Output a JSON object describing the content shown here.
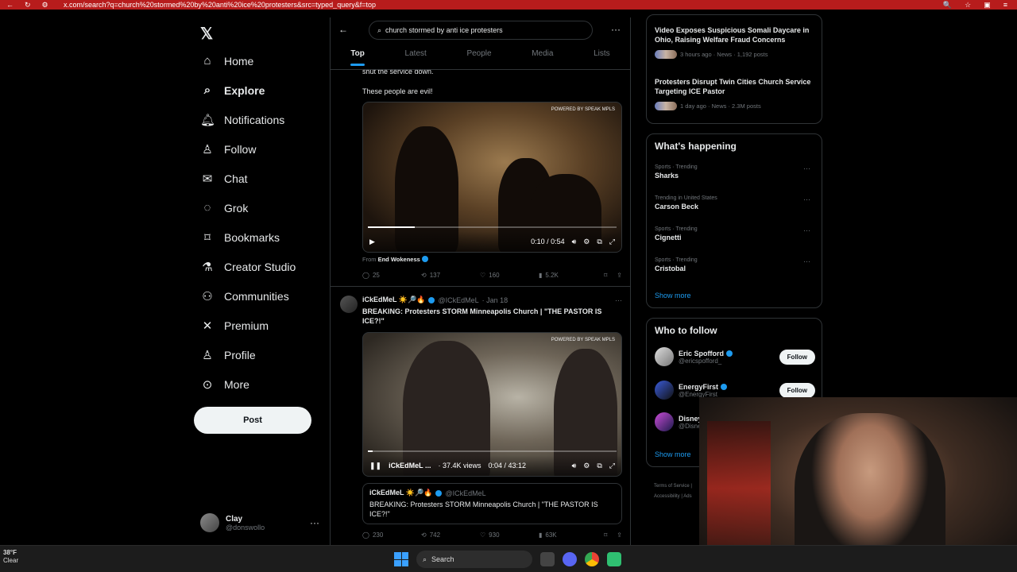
{
  "browser": {
    "url": "x.com/search?q=church%20stormed%20by%20anti%20ice%20protesters&src=typed_query&f=top"
  },
  "nav": {
    "items": [
      {
        "label": "Home",
        "icon": "home-icon"
      },
      {
        "label": "Explore",
        "icon": "search-icon"
      },
      {
        "label": "Notifications",
        "icon": "bell-icon"
      },
      {
        "label": "Follow",
        "icon": "person-add-icon"
      },
      {
        "label": "Chat",
        "icon": "envelope-icon"
      },
      {
        "label": "Grok",
        "icon": "grok-icon"
      },
      {
        "label": "Bookmarks",
        "icon": "bookmark-icon"
      },
      {
        "label": "Creator Studio",
        "icon": "flask-icon"
      },
      {
        "label": "Communities",
        "icon": "people-icon"
      },
      {
        "label": "Premium",
        "icon": "x-logo-icon"
      },
      {
        "label": "Profile",
        "icon": "person-icon"
      },
      {
        "label": "More",
        "icon": "more-circle-icon"
      }
    ],
    "post_label": "Post",
    "user": {
      "name": "Clay",
      "handle": "@donswollo"
    }
  },
  "search": {
    "query": "church stormed by anti ice protesters",
    "tabs": [
      "Top",
      "Latest",
      "People",
      "Media",
      "Lists"
    ]
  },
  "tweet1": {
    "text_partial": "shut the service down.",
    "text": "These people are evil!",
    "video_time": "0:10 / 0:54",
    "video_progress": 0.19,
    "badge": "POWERED BY SPEAK MPLS",
    "from_label": "From",
    "from_name": "End Wokeness",
    "replies": "25",
    "reposts": "137",
    "likes": "160",
    "views": "5.2K"
  },
  "tweet2": {
    "name": "iCkEdMeL ☀️🔎🔥",
    "handle": "@ICkEdMeL",
    "date": "· Jan 18",
    "text": "BREAKING: Protesters STORM Minneapolis Church | \"THE PASTOR IS ICE?!\"",
    "video_channel": "iCkEdMeL ...",
    "video_views": "· 37.4K views",
    "video_time": "0:04 / 43:12",
    "video_progress": 0.02,
    "badge": "POWERED BY SPEAK MPLS",
    "quote_name": "iCkEdMeL ☀️🔎🔥",
    "quote_handle": "@ICkEdMeL",
    "quote_text": "BREAKING: Protesters STORM Minneapolis Church | \"THE PASTOR IS ICE?!\"",
    "replies": "230",
    "reposts": "742",
    "likes": "930",
    "views": "63K"
  },
  "news": [
    {
      "title": "Video Exposes Suspicious Somali Daycare in Ohio, Raising Welfare Fraud Concerns",
      "meta": "3 hours ago · News · 1,192 posts"
    },
    {
      "title": "Protesters Disrupt Twin Cities Church Service Targeting ICE Pastor",
      "meta": "1 day ago · News · 2.3M posts"
    }
  ],
  "happening": {
    "title": "What's happening",
    "trends": [
      {
        "category": "Sports · Trending",
        "name": "Sharks"
      },
      {
        "category": "Trending in United States",
        "name": "Carson Beck"
      },
      {
        "category": "Sports · Trending",
        "name": "Cignetti"
      },
      {
        "category": "Sports · Trending",
        "name": "Cristobal"
      }
    ],
    "show_more": "Show more"
  },
  "who_to_follow": {
    "title": "Who to follow",
    "users": [
      {
        "name": "Eric Spofford",
        "handle": "@ericspofford_",
        "button": "Follow"
      },
      {
        "name": "EnergyFirst",
        "handle": "@EnergyFirst",
        "button": "Follow"
      },
      {
        "name": "Disney",
        "handle": "@Disney",
        "button": ""
      }
    ],
    "show_more": "Show more"
  },
  "footer": {
    "terms": "Terms of Service",
    "accessibility": "Accessibility",
    "ads": "Ads"
  },
  "taskbar": {
    "temp": "38°F",
    "condition": "Clear",
    "search_label": "Search"
  },
  "colors": {
    "accent": "#1d9bf0",
    "chrome": "#b71c1c",
    "background": "#000000"
  }
}
